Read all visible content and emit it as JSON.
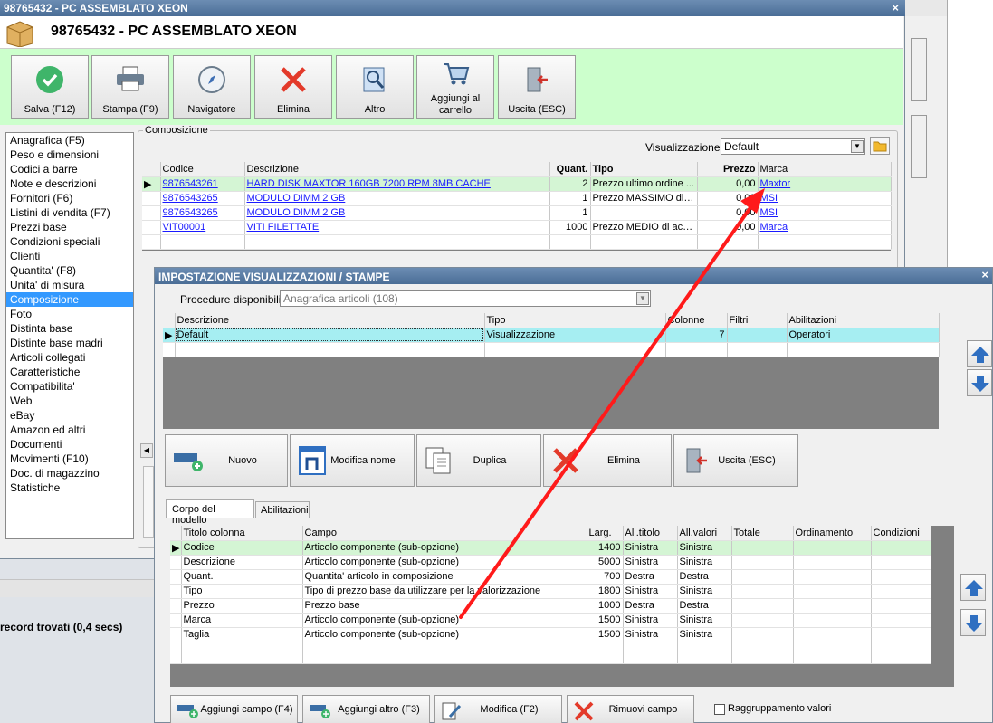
{
  "main_window": {
    "title": "98765432 - PC ASSEMBLATO XEON",
    "header_title": "98765432 - PC ASSEMBLATO XEON",
    "toolbar": [
      {
        "label": "Salva (F12)",
        "icon": "check-icon"
      },
      {
        "label": "Stampa (F9)",
        "icon": "printer-icon"
      },
      {
        "label": "Navigatore",
        "icon": "compass-icon"
      },
      {
        "label": "Elimina",
        "icon": "delete-x-icon"
      },
      {
        "label": "Altro",
        "icon": "magnifier-icon"
      },
      {
        "label": "Aggiungi al carrello",
        "icon": "cart-icon"
      },
      {
        "label": "Uscita (ESC)",
        "icon": "exit-door-icon"
      }
    ],
    "nav_items": [
      "Anagrafica (F5)",
      "Peso e dimensioni",
      "Codici a barre",
      "Note e descrizioni",
      "Fornitori (F6)",
      "Listini di vendita (F7)",
      "Prezzi base",
      "Condizioni speciali",
      "Clienti",
      "Quantita' (F8)",
      "Unita' di misura",
      "Composizione",
      "Foto",
      "Distinta base",
      "Distinte base madri",
      "Articoli collegati",
      "Caratteristiche",
      "Compatibilita'",
      "Web",
      "eBay",
      "Amazon ed altri",
      "Documenti",
      "Movimenti (F10)",
      "Doc. di magazzino",
      "Statistiche"
    ],
    "nav_selected": "Composizione",
    "group_label": "Composizione",
    "view_label": "Visualizzazione :",
    "view_value": "Default",
    "grid": {
      "columns": [
        "Codice",
        "Descrizione",
        "Quant.",
        "Tipo",
        "Prezzo",
        "Marca"
      ],
      "rows": [
        {
          "codice": "9876543261",
          "descrizione": "HARD DISK MAXTOR 160GB 7200 RPM 8MB CACHE",
          "quant": "2",
          "tipo": "Prezzo ultimo ordine ...",
          "prezzo": "0,00",
          "marca": "Maxtor"
        },
        {
          "codice": "9876543265",
          "descrizione": "MODULO DIMM 2 GB",
          "quant": "1",
          "tipo": "Prezzo MASSIMO di a...",
          "prezzo": "0,00",
          "marca": "MSI"
        },
        {
          "codice": "9876543265",
          "descrizione": "MODULO DIMM 2 GB",
          "quant": "1",
          "tipo": "",
          "prezzo": "0,00",
          "marca": "MSI"
        },
        {
          "codice": "VIT00001",
          "descrizione": "VITI FILETTATE",
          "quant": "1000",
          "tipo": "Prezzo MEDIO di acq...",
          "prezzo": "0,00",
          "marca": "Marca"
        }
      ]
    },
    "status_text": "record trovati (0,4 secs)"
  },
  "dialog": {
    "title": "IMPOSTAZIONE VISUALIZZAZIONI / STAMPE",
    "proc_label": "Procedure disponibili :",
    "proc_value": "Anagrafica articoli (108)",
    "views_grid": {
      "columns": [
        "Descrizione",
        "Tipo",
        "Colonne",
        "Filtri",
        "Abilitazioni"
      ],
      "rows": [
        {
          "descrizione": "Default",
          "tipo": "Visualizzazione",
          "colonne": "7",
          "filtri": "",
          "abilitazioni": "Operatori"
        }
      ]
    },
    "buttons": [
      {
        "label": "Nuovo",
        "icon": "new-item-icon"
      },
      {
        "label": "Modifica nome",
        "icon": "rename-icon"
      },
      {
        "label": "Duplica",
        "icon": "duplicate-icon"
      },
      {
        "label": "Elimina",
        "icon": "delete-x-icon"
      },
      {
        "label": "Uscita (ESC)",
        "icon": "exit-door-icon"
      }
    ],
    "tabs": [
      "Corpo del modello",
      "Abilitazioni"
    ],
    "model_grid": {
      "columns": [
        "Titolo colonna",
        "Campo",
        "Larg.",
        "All.titolo",
        "All.valori",
        "Totale",
        "Ordinamento",
        "Condizioni"
      ],
      "rows": [
        {
          "titolo": "Codice",
          "campo": "Articolo componente (sub-opzione)",
          "larg": "1400",
          "alltitolo": "Sinistra",
          "allvalori": "Sinistra"
        },
        {
          "titolo": "Descrizione",
          "campo": "Articolo componente (sub-opzione)",
          "larg": "5000",
          "alltitolo": "Sinistra",
          "allvalori": "Sinistra"
        },
        {
          "titolo": "Quant.",
          "campo": "Quantita' articolo in composizione",
          "larg": "700",
          "alltitolo": "Destra",
          "allvalori": "Destra"
        },
        {
          "titolo": "Tipo",
          "campo": "Tipo di prezzo base da utilizzare per la valorizzazione",
          "larg": "1800",
          "alltitolo": "Sinistra",
          "allvalori": "Sinistra"
        },
        {
          "titolo": "Prezzo",
          "campo": "Prezzo base",
          "larg": "1000",
          "alltitolo": "Destra",
          "allvalori": "Destra"
        },
        {
          "titolo": "Marca",
          "campo": "Articolo componente (sub-opzione)",
          "larg": "1500",
          "alltitolo": "Sinistra",
          "allvalori": "Sinistra"
        },
        {
          "titolo": "Taglia",
          "campo": "Articolo componente (sub-opzione)",
          "larg": "1500",
          "alltitolo": "Sinistra",
          "allvalori": "Sinistra"
        }
      ]
    },
    "bottom_buttons": [
      {
        "label": "Aggiungi campo (F4)",
        "icon": "add-field-icon"
      },
      {
        "label": "Aggiungi altro (F3)",
        "icon": "add-other-icon"
      },
      {
        "label": "Modifica (F2)",
        "icon": "edit-icon"
      },
      {
        "label": "Rimuovi campo",
        "icon": "remove-x-icon"
      }
    ],
    "group_checkbox": "Raggruppamento valori"
  },
  "colors": {
    "accent_green": "#ccffcc",
    "selection_blue": "#3399ff",
    "row_cyan": "#a6eef2",
    "annotation_red": "#ff1a1a"
  }
}
